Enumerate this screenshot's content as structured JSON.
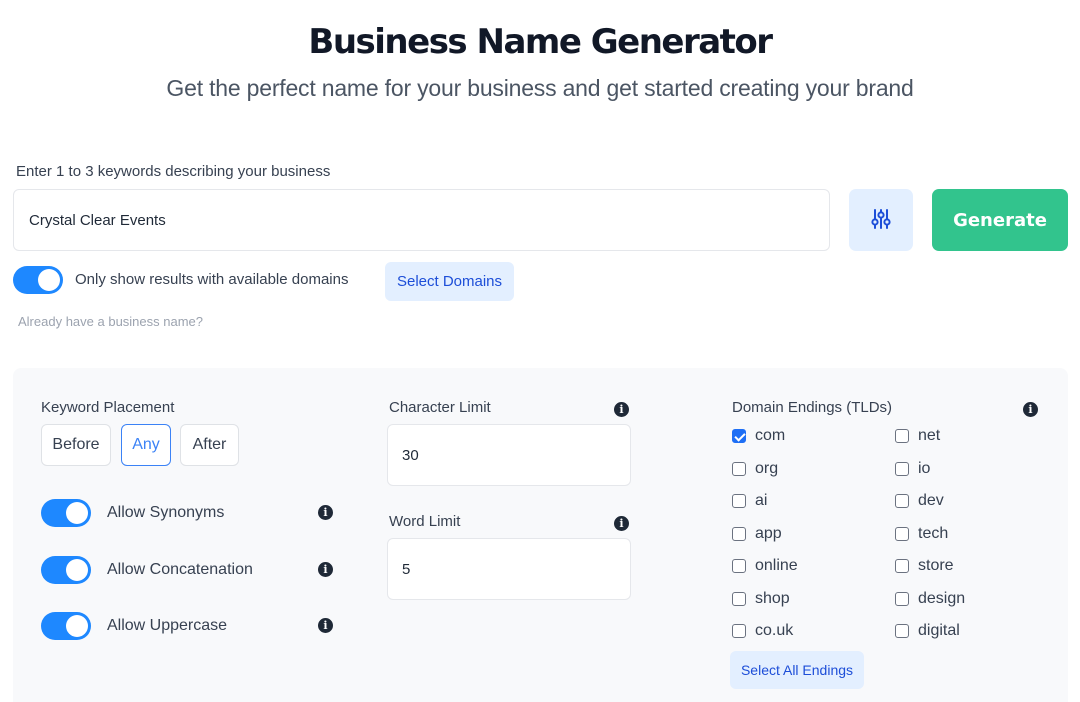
{
  "header": {
    "title": "Business Name Generator",
    "subtitle": "Get the perfect name for your business and get started creating your brand"
  },
  "search": {
    "label": "Enter 1 to 3 keywords describing your business",
    "value": "Crystal Clear Events",
    "filter_icon": "sliders-icon",
    "generate_label": "Generate"
  },
  "availability": {
    "toggle_on": true,
    "label": "Only show results with available domains",
    "select_domains_label": "Select Domains",
    "already_have_name": "Already have a business name?"
  },
  "options": {
    "keyword_placement": {
      "label": "Keyword Placement",
      "choices": [
        "Before",
        "Any",
        "After"
      ],
      "selected": "Any"
    },
    "toggles": [
      {
        "label": "Allow Synonyms",
        "on": true,
        "info_icon": "info-icon"
      },
      {
        "label": "Allow Concatenation",
        "on": true,
        "info_icon": "info-icon"
      },
      {
        "label": "Allow Uppercase",
        "on": true,
        "info_icon": "info-icon"
      }
    ],
    "character_limit": {
      "label": "Character Limit",
      "value": "30"
    },
    "word_limit": {
      "label": "Word Limit",
      "value": "5"
    },
    "domain_endings": {
      "label": "Domain Endings (TLDs)",
      "items": [
        {
          "label": "com",
          "checked": true
        },
        {
          "label": "net",
          "checked": false
        },
        {
          "label": "org",
          "checked": false
        },
        {
          "label": "io",
          "checked": false
        },
        {
          "label": "ai",
          "checked": false
        },
        {
          "label": "dev",
          "checked": false
        },
        {
          "label": "app",
          "checked": false
        },
        {
          "label": "tech",
          "checked": false
        },
        {
          "label": "online",
          "checked": false
        },
        {
          "label": "store",
          "checked": false
        },
        {
          "label": "shop",
          "checked": false
        },
        {
          "label": "design",
          "checked": false
        },
        {
          "label": "co.uk",
          "checked": false
        },
        {
          "label": "digital",
          "checked": false
        }
      ],
      "select_all_label": "Select All Endings"
    }
  },
  "colors": {
    "accent_blue": "#1e88ff",
    "generate_green": "#32c48d",
    "light_blue_bg": "#e3efff",
    "link_blue": "#1d4ed8"
  }
}
